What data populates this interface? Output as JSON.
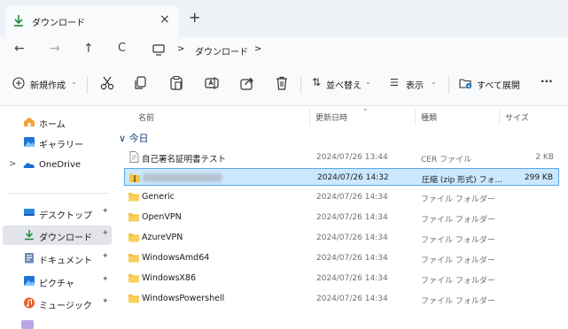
{
  "tab": {
    "title": "ダウンロード",
    "close": "×",
    "new_tab": "+"
  },
  "nav": {
    "back": "←",
    "forward": "→",
    "up": "↑",
    "refresh": "C"
  },
  "breadcrumb": {
    "separator": ">",
    "current": "ダウンロード"
  },
  "commands": {
    "new": "新規作成",
    "sort": "並べ替え",
    "view": "表示",
    "expand_all": "すべて展開",
    "more": "···"
  },
  "sidebar": {
    "items": [
      {
        "label": "ホーム",
        "icon": "home-icon"
      },
      {
        "label": "ギャラリー",
        "icon": "gallery-icon"
      },
      {
        "label": "OneDrive",
        "icon": "onedrive-icon"
      },
      {
        "label": "デスクトップ",
        "icon": "desktop-icon"
      },
      {
        "label": "ダウンロード",
        "icon": "download-icon"
      },
      {
        "label": "ドキュメント",
        "icon": "documents-icon"
      },
      {
        "label": "ピクチャ",
        "icon": "pictures-icon"
      },
      {
        "label": "ミュージック",
        "icon": "music-icon"
      }
    ],
    "expand_glyph": ">",
    "pin_glyph": "📌"
  },
  "columns": {
    "name": "名前",
    "modified": "更新日時",
    "type": "種類",
    "size": "サイズ"
  },
  "group": {
    "chevron": "∨",
    "label": "今日"
  },
  "files": [
    {
      "name": "自己署名証明書テスト",
      "modified": "2024/07/26 13:44",
      "type": "CER ファイル",
      "size": "2 KB",
      "kind": "cert"
    },
    {
      "name": "",
      "modified": "2024/07/26 14:32",
      "type": "圧縮 (zip 形式) フォ...",
      "size": "299 KB",
      "kind": "zip"
    },
    {
      "name": "Generic",
      "modified": "2024/07/26 14:34",
      "type": "ファイル フォルダー",
      "size": "",
      "kind": "folder"
    },
    {
      "name": "OpenVPN",
      "modified": "2024/07/26 14:34",
      "type": "ファイル フォルダー",
      "size": "",
      "kind": "folder"
    },
    {
      "name": "AzureVPN",
      "modified": "2024/07/26 14:34",
      "type": "ファイル フォルダー",
      "size": "",
      "kind": "folder"
    },
    {
      "name": "WindowsAmd64",
      "modified": "2024/07/26 14:34",
      "type": "ファイル フォルダー",
      "size": "",
      "kind": "folder"
    },
    {
      "name": "WindowsX86",
      "modified": "2024/07/26 14:34",
      "type": "ファイル フォルダー",
      "size": "",
      "kind": "folder"
    },
    {
      "name": "WindowsPowershell",
      "modified": "2024/07/26 14:34",
      "type": "ファイル フォルダー",
      "size": "",
      "kind": "folder"
    }
  ],
  "colors": {
    "accent": "#0067c0",
    "selection": "#cce8ff",
    "folder": "#f5c342"
  }
}
